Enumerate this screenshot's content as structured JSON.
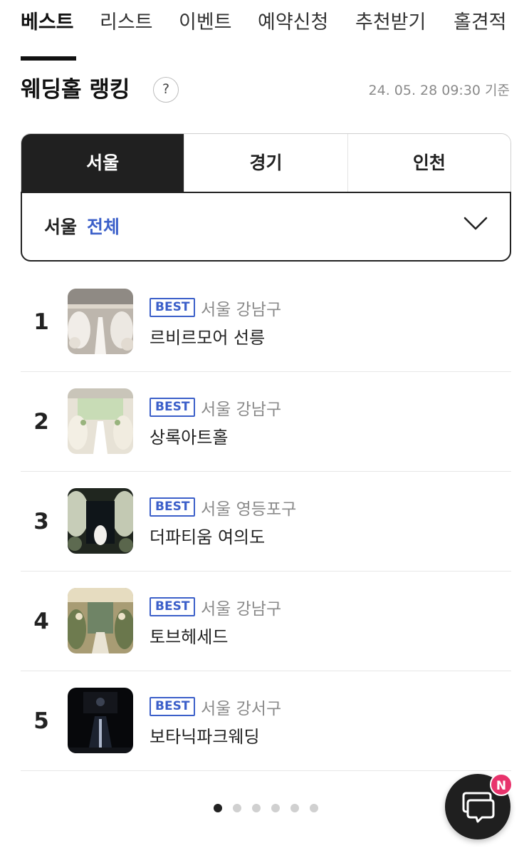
{
  "top_tabs": [
    "베스트",
    "리스트",
    "이벤트",
    "예약신청",
    "추천받기",
    "홀견적"
  ],
  "active_tab": 0,
  "ranking": {
    "title": "웨딩홀 랭킹",
    "help_symbol": "?",
    "timestamp": "24. 05. 28 09:30 기준"
  },
  "regions": {
    "tabs": [
      "서울",
      "경기",
      "인천"
    ],
    "active": 0,
    "select_city": "서울",
    "select_district": "전체"
  },
  "badge_label": "BEST",
  "venues": [
    {
      "rank": "1",
      "location": "서울 강남구",
      "name": "르비르모어 선릉"
    },
    {
      "rank": "2",
      "location": "서울 강남구",
      "name": "상록아트홀"
    },
    {
      "rank": "3",
      "location": "서울 영등포구",
      "name": "더파티움 여의도"
    },
    {
      "rank": "4",
      "location": "서울 강남구",
      "name": "토브헤세드"
    },
    {
      "rank": "5",
      "location": "서울 강서구",
      "name": "보타닉파크웨딩"
    }
  ],
  "pagination": {
    "total": 6,
    "current": 1
  },
  "chat": {
    "badge": "N"
  },
  "colors": {
    "accent_blue": "#3b5fc9",
    "active_region_bg": "#202020",
    "new_badge": "#e8336c",
    "muted_text": "#8a8a8a"
  },
  "icons": {
    "help": "help-icon",
    "dropdown": "chevron-down-icon",
    "chat": "chat-bubbles-icon"
  }
}
